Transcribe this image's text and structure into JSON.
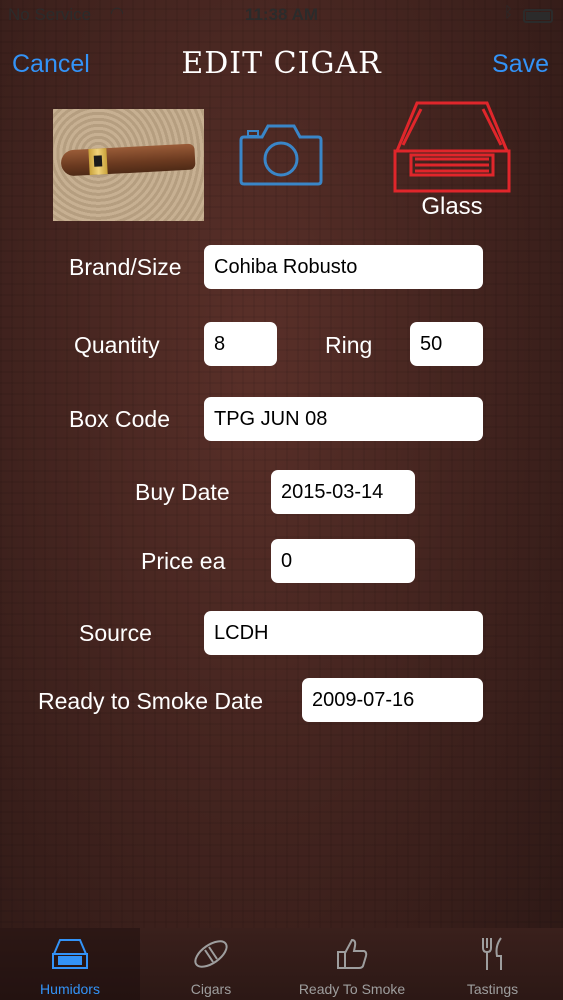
{
  "status_bar": {
    "carrier": "No Service",
    "time": "11:38 AM"
  },
  "nav": {
    "cancel_label": "Cancel",
    "title": "EDIT CIGAR",
    "save_label": "Save"
  },
  "humidor_type": {
    "label": "Glass",
    "icon": "glass-humidor-icon",
    "color": "#e0262b"
  },
  "camera": {
    "icon": "camera-icon",
    "color": "#3a86c8"
  },
  "form": {
    "brand_size": {
      "label": "Brand/Size",
      "value": "Cohiba Robusto"
    },
    "quantity": {
      "label": "Quantity",
      "value": "8"
    },
    "ring": {
      "label": "Ring",
      "value": "50"
    },
    "box_code": {
      "label": "Box Code",
      "value": "TPG JUN 08"
    },
    "buy_date": {
      "label": "Buy Date",
      "value": "2015-03-14"
    },
    "price_ea": {
      "label": "Price ea",
      "value": "0"
    },
    "source": {
      "label": "Source",
      "value": "LCDH"
    },
    "ready_date": {
      "label": "Ready to Smoke Date",
      "value": "2009-07-16"
    }
  },
  "tabs": [
    {
      "label": "Humidors",
      "icon": "humidor-icon",
      "active": true
    },
    {
      "label": "Cigars",
      "icon": "cigar-icon",
      "active": false
    },
    {
      "label": "Ready To Smoke",
      "icon": "thumbs-up-icon",
      "active": false
    },
    {
      "label": "Tastings",
      "icon": "fork-knife-icon",
      "active": false
    }
  ],
  "colors": {
    "accent": "#3393f7",
    "tab_inactive": "#9e9e9e"
  }
}
